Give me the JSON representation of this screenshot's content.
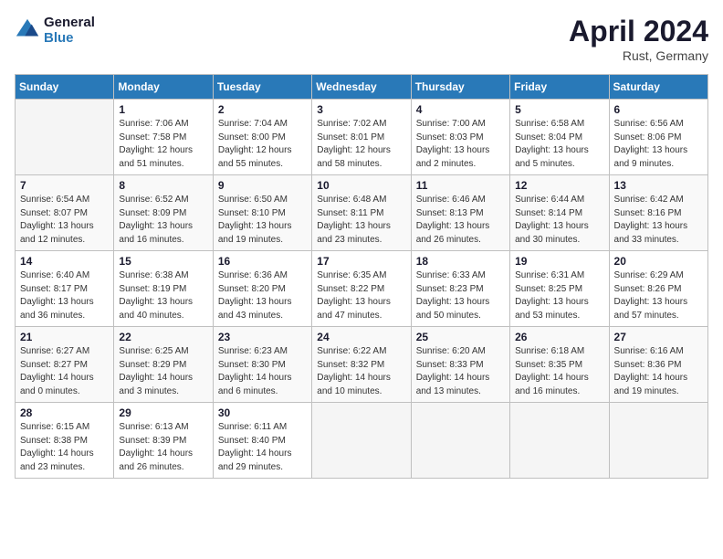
{
  "header": {
    "logo_line1": "General",
    "logo_line2": "Blue",
    "month": "April 2024",
    "location": "Rust, Germany"
  },
  "weekdays": [
    "Sunday",
    "Monday",
    "Tuesday",
    "Wednesday",
    "Thursday",
    "Friday",
    "Saturday"
  ],
  "weeks": [
    [
      {
        "day": "",
        "info": ""
      },
      {
        "day": "1",
        "info": "Sunrise: 7:06 AM\nSunset: 7:58 PM\nDaylight: 12 hours\nand 51 minutes."
      },
      {
        "day": "2",
        "info": "Sunrise: 7:04 AM\nSunset: 8:00 PM\nDaylight: 12 hours\nand 55 minutes."
      },
      {
        "day": "3",
        "info": "Sunrise: 7:02 AM\nSunset: 8:01 PM\nDaylight: 12 hours\nand 58 minutes."
      },
      {
        "day": "4",
        "info": "Sunrise: 7:00 AM\nSunset: 8:03 PM\nDaylight: 13 hours\nand 2 minutes."
      },
      {
        "day": "5",
        "info": "Sunrise: 6:58 AM\nSunset: 8:04 PM\nDaylight: 13 hours\nand 5 minutes."
      },
      {
        "day": "6",
        "info": "Sunrise: 6:56 AM\nSunset: 8:06 PM\nDaylight: 13 hours\nand 9 minutes."
      }
    ],
    [
      {
        "day": "7",
        "info": "Sunrise: 6:54 AM\nSunset: 8:07 PM\nDaylight: 13 hours\nand 12 minutes."
      },
      {
        "day": "8",
        "info": "Sunrise: 6:52 AM\nSunset: 8:09 PM\nDaylight: 13 hours\nand 16 minutes."
      },
      {
        "day": "9",
        "info": "Sunrise: 6:50 AM\nSunset: 8:10 PM\nDaylight: 13 hours\nand 19 minutes."
      },
      {
        "day": "10",
        "info": "Sunrise: 6:48 AM\nSunset: 8:11 PM\nDaylight: 13 hours\nand 23 minutes."
      },
      {
        "day": "11",
        "info": "Sunrise: 6:46 AM\nSunset: 8:13 PM\nDaylight: 13 hours\nand 26 minutes."
      },
      {
        "day": "12",
        "info": "Sunrise: 6:44 AM\nSunset: 8:14 PM\nDaylight: 13 hours\nand 30 minutes."
      },
      {
        "day": "13",
        "info": "Sunrise: 6:42 AM\nSunset: 8:16 PM\nDaylight: 13 hours\nand 33 minutes."
      }
    ],
    [
      {
        "day": "14",
        "info": "Sunrise: 6:40 AM\nSunset: 8:17 PM\nDaylight: 13 hours\nand 36 minutes."
      },
      {
        "day": "15",
        "info": "Sunrise: 6:38 AM\nSunset: 8:19 PM\nDaylight: 13 hours\nand 40 minutes."
      },
      {
        "day": "16",
        "info": "Sunrise: 6:36 AM\nSunset: 8:20 PM\nDaylight: 13 hours\nand 43 minutes."
      },
      {
        "day": "17",
        "info": "Sunrise: 6:35 AM\nSunset: 8:22 PM\nDaylight: 13 hours\nand 47 minutes."
      },
      {
        "day": "18",
        "info": "Sunrise: 6:33 AM\nSunset: 8:23 PM\nDaylight: 13 hours\nand 50 minutes."
      },
      {
        "day": "19",
        "info": "Sunrise: 6:31 AM\nSunset: 8:25 PM\nDaylight: 13 hours\nand 53 minutes."
      },
      {
        "day": "20",
        "info": "Sunrise: 6:29 AM\nSunset: 8:26 PM\nDaylight: 13 hours\nand 57 minutes."
      }
    ],
    [
      {
        "day": "21",
        "info": "Sunrise: 6:27 AM\nSunset: 8:27 PM\nDaylight: 14 hours\nand 0 minutes."
      },
      {
        "day": "22",
        "info": "Sunrise: 6:25 AM\nSunset: 8:29 PM\nDaylight: 14 hours\nand 3 minutes."
      },
      {
        "day": "23",
        "info": "Sunrise: 6:23 AM\nSunset: 8:30 PM\nDaylight: 14 hours\nand 6 minutes."
      },
      {
        "day": "24",
        "info": "Sunrise: 6:22 AM\nSunset: 8:32 PM\nDaylight: 14 hours\nand 10 minutes."
      },
      {
        "day": "25",
        "info": "Sunrise: 6:20 AM\nSunset: 8:33 PM\nDaylight: 14 hours\nand 13 minutes."
      },
      {
        "day": "26",
        "info": "Sunrise: 6:18 AM\nSunset: 8:35 PM\nDaylight: 14 hours\nand 16 minutes."
      },
      {
        "day": "27",
        "info": "Sunrise: 6:16 AM\nSunset: 8:36 PM\nDaylight: 14 hours\nand 19 minutes."
      }
    ],
    [
      {
        "day": "28",
        "info": "Sunrise: 6:15 AM\nSunset: 8:38 PM\nDaylight: 14 hours\nand 23 minutes."
      },
      {
        "day": "29",
        "info": "Sunrise: 6:13 AM\nSunset: 8:39 PM\nDaylight: 14 hours\nand 26 minutes."
      },
      {
        "day": "30",
        "info": "Sunrise: 6:11 AM\nSunset: 8:40 PM\nDaylight: 14 hours\nand 29 minutes."
      },
      {
        "day": "",
        "info": ""
      },
      {
        "day": "",
        "info": ""
      },
      {
        "day": "",
        "info": ""
      },
      {
        "day": "",
        "info": ""
      }
    ]
  ]
}
